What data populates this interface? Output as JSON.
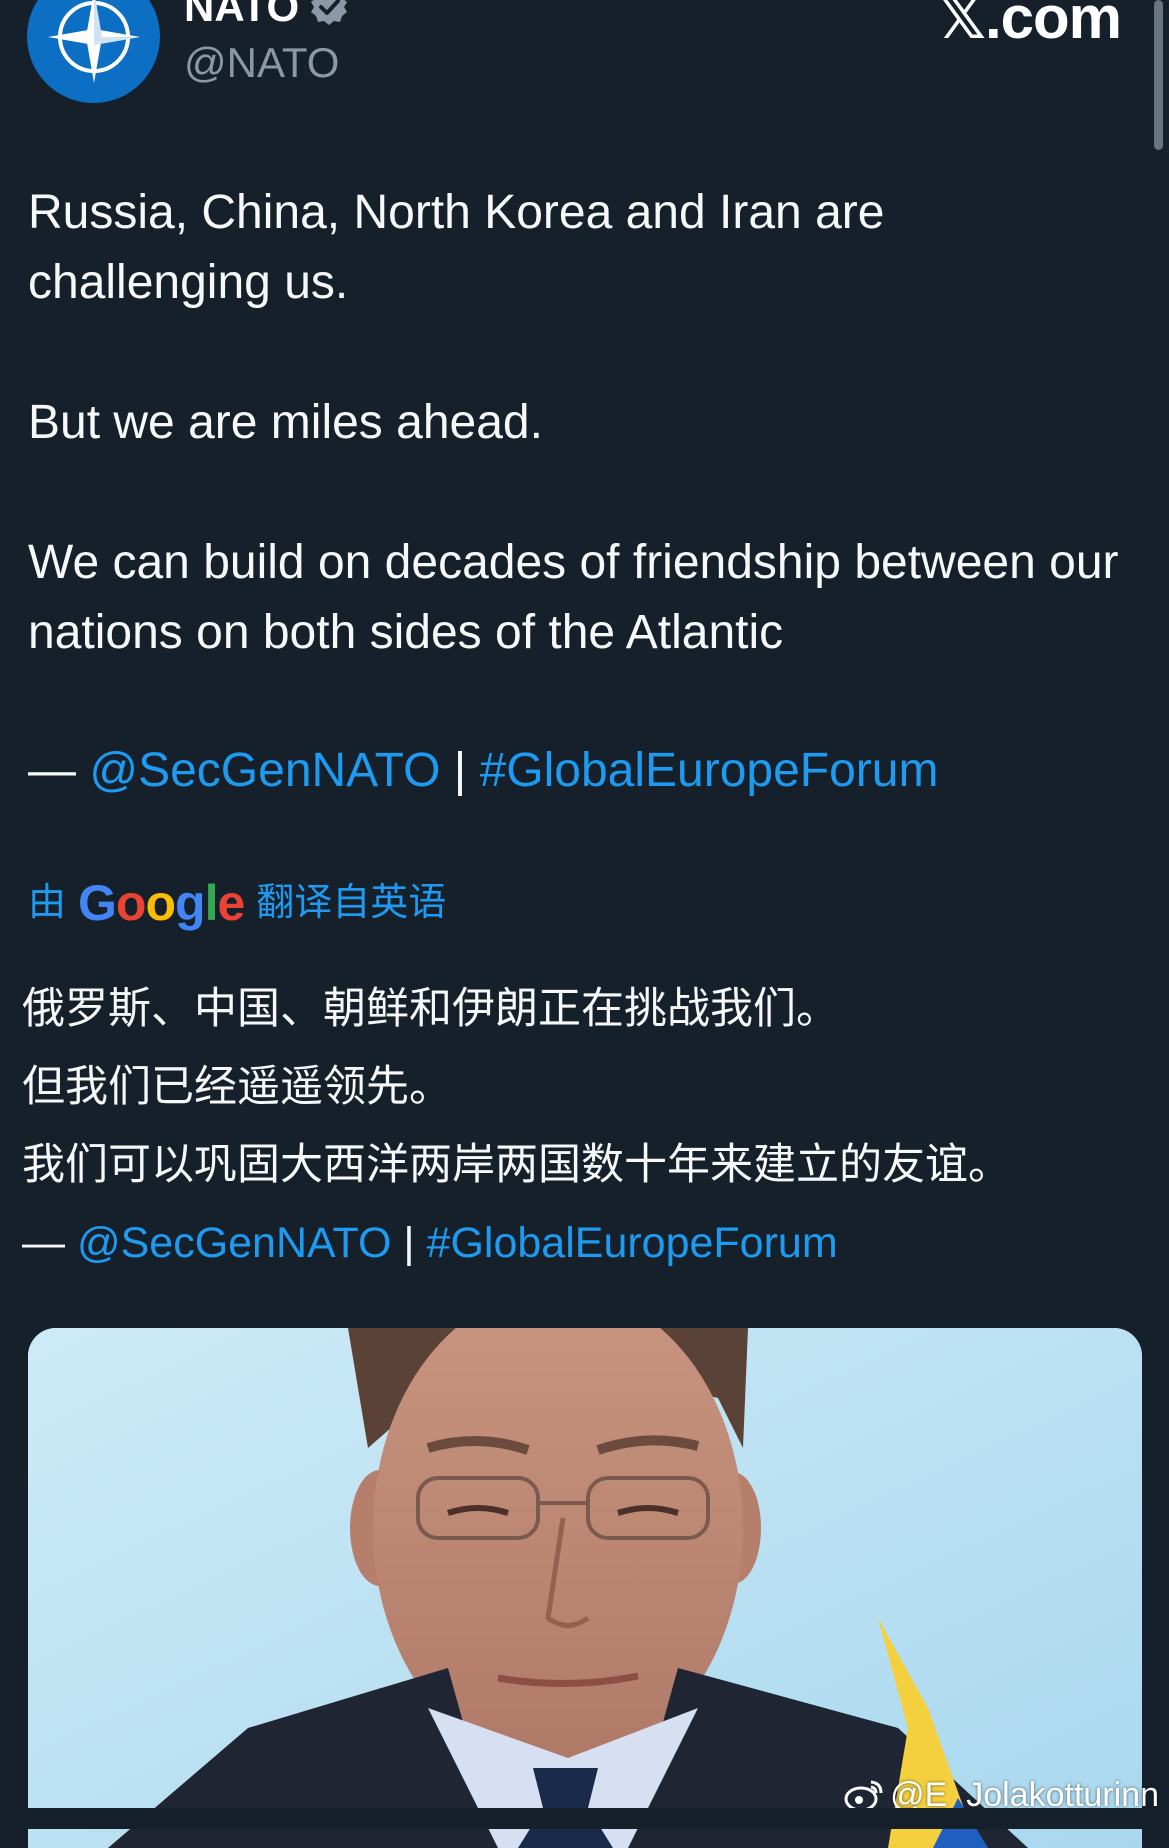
{
  "header": {
    "display_name": "NATO",
    "handle": "@NATO",
    "brand": "𝕏.com",
    "avatar_icon": "nato-compass-star-icon",
    "verified_icon": "verified-badge-icon"
  },
  "tweet": {
    "paragraph_1": "Russia, China, North Korea and Iran are challenging us.",
    "paragraph_2": "But we are miles ahead.",
    "paragraph_3": "We can build on decades of friendship between our nations on both sides of the Atlantic",
    "credit_prefix": "— ",
    "mention": "@SecGenNATO",
    "separator": " | ",
    "hashtag": "#GlobalEuropeForum"
  },
  "translation": {
    "prefix": "由",
    "provider": "Google",
    "suffix": "翻译自英语",
    "line_1": "俄罗斯、中国、朝鲜和伊朗正在挑战我们。",
    "line_2": "但我们已经遥遥领先。",
    "line_3": "我们可以巩固大西洋两岸两国数十年来建立的友谊。",
    "credit_prefix": "— ",
    "mention": "@SecGenNATO",
    "separator": " | ",
    "hashtag": "#GlobalEuropeForum"
  },
  "media": {
    "alt": "video-frame"
  },
  "watermark": {
    "icon": "weibo-icon",
    "text": "@E_Jolakotturinn"
  },
  "colors": {
    "background": "#15202b",
    "link": "#1d9bf0",
    "secondary_text": "#8b98a5",
    "nato_blue": "#0d6fc4"
  }
}
